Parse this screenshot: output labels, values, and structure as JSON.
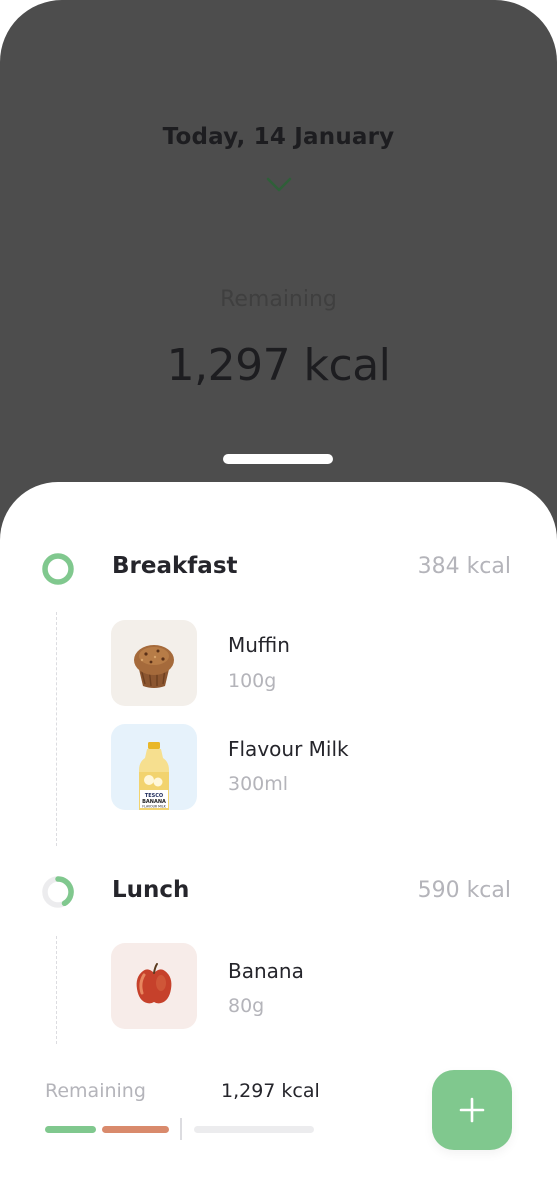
{
  "header": {
    "date_label": "Today, 14 January",
    "remaining_label": "Remaining",
    "remaining_value": "1,297 kcal"
  },
  "meals": [
    {
      "title": "Breakfast",
      "kcal": "384 kcal",
      "items": [
        {
          "name": "Muffin",
          "qty": "100g",
          "icon": "muffin-image"
        },
        {
          "name": "Flavour Milk",
          "qty": "300ml",
          "icon": "milk-bottle-image",
          "bottle_text": [
            "TESCO",
            "BANANA",
            "FLAVOUR MILK"
          ]
        }
      ]
    },
    {
      "title": "Lunch",
      "kcal": "590 kcal",
      "items": [
        {
          "name": "Banana",
          "qty": "80g",
          "icon": "apple-image"
        }
      ]
    }
  ],
  "footer": {
    "remaining_label": "Remaining",
    "remaining_value": "1,297 kcal",
    "add_icon": "plus-icon"
  },
  "colors": {
    "accent_green": "#80c88e",
    "accent_orange": "#d98a6c",
    "track_gray": "#ececee",
    "overlay_gray": "#4d4d4d"
  }
}
